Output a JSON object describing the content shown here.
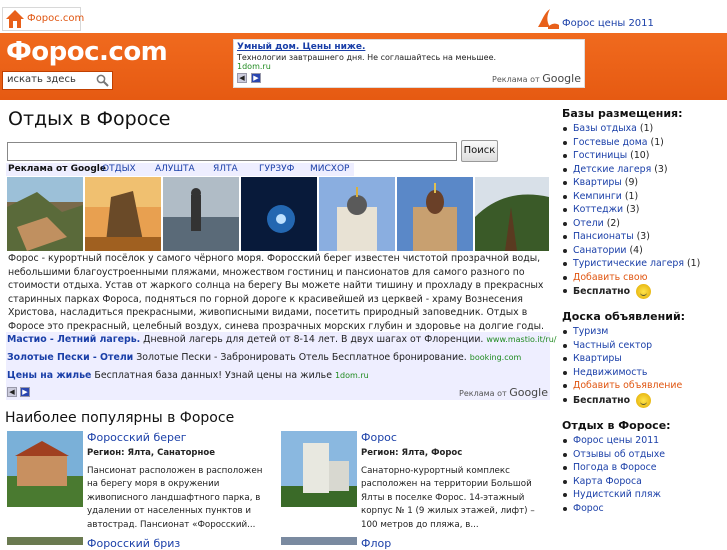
{
  "topbar": {
    "logo_text": "Форос.com",
    "right_link": "Форос цены 2011"
  },
  "header": {
    "brand": "Форос.com",
    "search_placeholder": "искать здесь",
    "ad": {
      "title": "Умный дом. Цены ниже.",
      "desc": "Технологии завтрашнего дня. Не соглашайтесь на меньшее.",
      "url": "1dom.ru",
      "by_label": "Реклама от",
      "by_brand": "Google"
    }
  },
  "main": {
    "title": "Отдых в Форосе",
    "search_button": "Поиск",
    "ads_label": "Реклама от Google",
    "tabs": [
      "ОТДЫХ",
      "АЛУШТА",
      "ЯЛТА",
      "ГУРЗУФ",
      "МИСХОР"
    ],
    "intro": "Форос - курортный посёлок у самого чёрного моря. Форосский берег известен чистотой прозрачной воды, небольшими благоустроенными пляжами, множеством гостиниц и пансионатов для самого разного по стоимости отдыха. Устав от жаркого солнца на берегу Вы можете найти тишину и прохладу в прекрасных старинных парках Фороса, подняться по горной дороге к красивейшей из церквей - храму Вознесения Христова, насладиться прекрасными, живописными видами, посетить природный заповедник. Отдых в Форосе это прекрасный, целебный воздух, синева прозрачных морских глубин и здоровье на долгие годы.",
    "text_ads": [
      {
        "title": "Мастио - Летний лагерь.",
        "desc": "Дневной лагерь для детей от 8-14 лет. В двух шагах от Флоренции.",
        "url": "www.mastio.it/ru/"
      },
      {
        "title": "Золотые Пески - Отели",
        "desc": "Золотые Пески - Забронировать Отель Бесплатное бронирование.",
        "url": "booking.com"
      },
      {
        "title": "Цены на жилье",
        "desc": "Бесплатная база данных! Узнай цены на жилье",
        "url": "1dom.ru"
      }
    ],
    "ads_by_label": "Реклама от",
    "ads_by_brand": "Google",
    "popular_title": "Наиболее популярны в Форосе",
    "cards": [
      {
        "title": "Форосский берег",
        "region": "Регион: Ялта, Санаторное",
        "desc": "Пансионат расположен в расположен на берегу моря в окружении живописного ландшафтного парка, в удалении от населенных пунктов и автострад. Пансионат «Форосский..."
      },
      {
        "title": "Форос",
        "region": "Регион: Ялта, Форос",
        "desc": "Санаторно-курортный комплекс расположен на территории Большой Ялты в поселке Форос. 14-этажный корпус № 1 (9 жилых этажей, лифт) – 100 метров до пляжа, в..."
      },
      {
        "title": "Форосский бриз",
        "region": "",
        "desc": ""
      },
      {
        "title": "Флор",
        "region": "",
        "desc": ""
      }
    ]
  },
  "sidebar": {
    "bases_title": "Базы размещения:",
    "bases": [
      {
        "label": "Базы отдыха",
        "count": "(1)"
      },
      {
        "label": "Гостевые дома",
        "count": "(1)"
      },
      {
        "label": "Гостиницы",
        "count": "(10)"
      },
      {
        "label": "Детские лагеря",
        "count": "(3)"
      },
      {
        "label": "Квартиры",
        "count": "(9)"
      },
      {
        "label": "Кемпинги",
        "count": "(1)"
      },
      {
        "label": "Коттеджи",
        "count": "(3)"
      },
      {
        "label": "Отели",
        "count": "(2)"
      },
      {
        "label": "Пансионаты",
        "count": "(3)"
      },
      {
        "label": "Санатории",
        "count": "(4)"
      },
      {
        "label": "Туристические лагеря",
        "count": "(1)"
      },
      {
        "label": "Добавить свою",
        "count": ""
      }
    ],
    "free_label": "Бесплатно",
    "board_title": "Доска объявлений:",
    "board": [
      "Туризм",
      "Частный сектор",
      "Квартиры",
      "Недвижимость",
      "Добавить объявление"
    ],
    "free_label2": "Бесплатно",
    "rest_title": "Отдых в Форосе:",
    "rest": [
      "Форос цены 2011",
      "Отзывы об отдыхе",
      "Погода в Форосе",
      "Карта Фороса",
      "Нудистский пляж",
      "Форос"
    ]
  },
  "colors": {
    "header": "#e65a12",
    "link": "#1a3fa8",
    "url": "#1f8a1f",
    "accent": "#e05510"
  }
}
